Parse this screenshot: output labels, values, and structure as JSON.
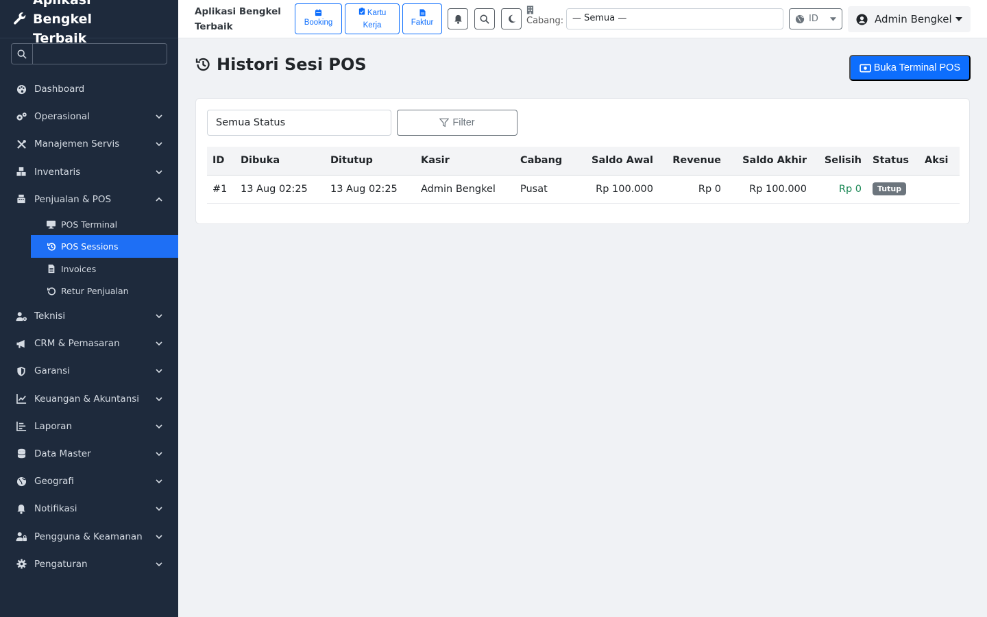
{
  "app": {
    "brand": "Aplikasi Bengkel Terbaik"
  },
  "sidebar": {
    "search_placeholder": "",
    "items": [
      {
        "label": "Dashboard",
        "icon": "palette-icon"
      },
      {
        "label": "Operasional",
        "icon": "gears-icon"
      },
      {
        "label": "Manajemen Servis",
        "icon": "tools-icon"
      },
      {
        "label": "Inventaris",
        "icon": "boxes-icon"
      },
      {
        "label": "Penjualan & POS",
        "icon": "cash-register-icon"
      },
      {
        "label": "Teknisi",
        "icon": "user-gear-icon"
      },
      {
        "label": "CRM & Pemasaran",
        "icon": "bullhorn-icon"
      },
      {
        "label": "Garansi",
        "icon": "shield-icon"
      },
      {
        "label": "Keuangan & Akuntansi",
        "icon": "chart-line-icon"
      },
      {
        "label": "Laporan",
        "icon": "chart-bar-icon"
      },
      {
        "label": "Data Master",
        "icon": "database-icon"
      },
      {
        "label": "Geografi",
        "icon": "globe-icon"
      },
      {
        "label": "Notifikasi",
        "icon": "bell-icon"
      },
      {
        "label": "Pengguna & Keamanan",
        "icon": "user-lock-icon"
      },
      {
        "label": "Pengaturan",
        "icon": "cog-icon"
      }
    ],
    "pos_sub": [
      {
        "label": "POS Terminal",
        "icon": "desktop-icon"
      },
      {
        "label": "POS Sessions",
        "icon": "history-icon"
      },
      {
        "label": "Invoices",
        "icon": "file-invoice-icon"
      },
      {
        "label": "Retur Penjualan",
        "icon": "undo-icon"
      }
    ]
  },
  "topbar": {
    "title": "Aplikasi Bengkel Terbaik",
    "quick": [
      {
        "label": "Booking",
        "icon": "calendar-icon"
      },
      {
        "label": "Kartu Kerja",
        "icon": "clipboard-icon"
      },
      {
        "label": "Faktur",
        "icon": "file-icon"
      }
    ],
    "cabang_label": "Cabang:",
    "cabang_value": "— Semua —",
    "lang_value": "ID",
    "user_name": "Admin Bengkel"
  },
  "page": {
    "title": "Histori Sesi POS",
    "open_terminal": "Buka Terminal POS",
    "status_filter": "Semua Status",
    "filter_button": "Filter"
  },
  "table": {
    "headers": [
      "ID",
      "Dibuka",
      "Ditutup",
      "Kasir",
      "Cabang",
      "Saldo Awal",
      "Revenue",
      "Saldo Akhir",
      "Selisih",
      "Status",
      "Aksi"
    ],
    "rows": [
      {
        "id": "#1",
        "opened": "13 Aug 02:25",
        "closed": "13 Aug 02:25",
        "cashier": "Admin Bengkel",
        "branch": "Pusat",
        "opening": "Rp 100.000",
        "revenue": "Rp 0",
        "closing": "Rp 100.000",
        "diff": "Rp 0",
        "status": "Tutup",
        "action": ""
      }
    ]
  },
  "colors": {
    "sidebar_bg": "#1e2a3c",
    "active": "#1e6ff5",
    "primary": "#0d6efd",
    "positive": "#198754",
    "badge": "#6c757d"
  }
}
